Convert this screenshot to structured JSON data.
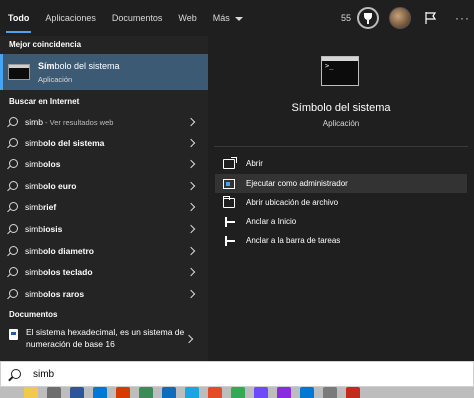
{
  "tabs": [
    {
      "label": "Todo",
      "active": true
    },
    {
      "label": "Aplicaciones",
      "active": false
    },
    {
      "label": "Documentos",
      "active": false
    },
    {
      "label": "Web",
      "active": false
    },
    {
      "label": "Más",
      "active": false
    }
  ],
  "header": {
    "points": "55"
  },
  "left": {
    "best_match_header": "Mejor coincidencia",
    "best_match": {
      "title_bold": "Sím",
      "title_rest": "bolo del sistema",
      "subtitle": "Aplicación"
    },
    "internet_header": "Buscar en Internet",
    "suggestions": [
      {
        "bold": "simb",
        "rest": "",
        "dim": " - Ver resultados web"
      },
      {
        "bold": "simb",
        "rest": "olo del sistema",
        "dim": ""
      },
      {
        "bold": "simb",
        "rest": "olos",
        "dim": ""
      },
      {
        "bold": "simb",
        "rest": "olo euro",
        "dim": ""
      },
      {
        "bold": "simb",
        "rest": "rief",
        "dim": ""
      },
      {
        "bold": "simb",
        "rest": "iosis",
        "dim": ""
      },
      {
        "bold": "simb",
        "rest": "olo diametro",
        "dim": ""
      },
      {
        "bold": "simb",
        "rest": "olos teclado",
        "dim": ""
      },
      {
        "bold": "simb",
        "rest": "olos raros",
        "dim": ""
      }
    ],
    "documents_header": "Documentos",
    "document": "El sistema hexadecimal, es un sistema de numeración de base 16"
  },
  "preview": {
    "title": "Símbolo del sistema",
    "subtitle": "Aplicación",
    "actions": [
      {
        "label": "Abrir",
        "icon": "open-icon"
      },
      {
        "label": "Ejecutar como administrador",
        "icon": "admin-shield-icon"
      },
      {
        "label": "Abrir ubicación de archivo",
        "icon": "folder-icon"
      },
      {
        "label": "Anclar a Inicio",
        "icon": "pin-icon"
      },
      {
        "label": "Anclar a la barra de tareas",
        "icon": "pin-icon"
      }
    ]
  },
  "search": {
    "value": "simb"
  },
  "colors": {
    "accent": "#4aa3f0",
    "selected_bg": "#3d5a75",
    "panel_bg": "#242424",
    "preview_bg": "#1f1f1f"
  },
  "taskbar_icons": [
    "#f2c94c",
    "#6d6d6d",
    "#2b579a",
    "#0078d4",
    "#d83b01",
    "#3c8c5a",
    "#0f6cbd",
    "#1aa5e3",
    "#e34c26",
    "#34a853",
    "#6e4aff",
    "#8a2be2",
    "#0078d4",
    "#7a7a7a",
    "#c42b1c"
  ]
}
